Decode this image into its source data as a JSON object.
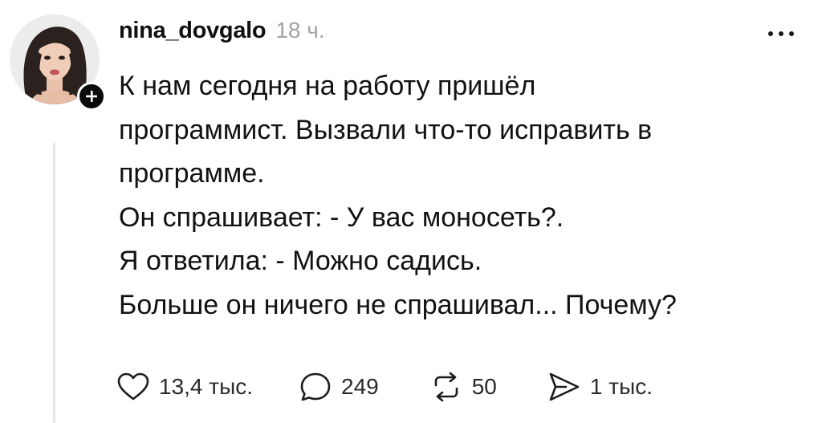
{
  "post": {
    "username": "nina_dovgalo",
    "timestamp": "18 ч.",
    "lines": [
      "К нам сегодня на работу пришёл",
      "программист. Вызвали что-то исправить в",
      "программе.",
      "Он спрашивает: - У вас моносеть?.",
      "Я ответила: - Можно садись.",
      "Больше он ничего не спрашивал... Почему?"
    ],
    "actions": {
      "likes": "13,4 тыс.",
      "replies": "249",
      "reposts": "50",
      "shares": "1 тыс."
    }
  },
  "icons": {
    "avatar": "avatar-photo",
    "follow": "plus-icon",
    "more": "more-dots-icon",
    "like": "heart-icon",
    "reply": "comment-bubble-icon",
    "repost": "repost-arrows-icon",
    "share": "send-icon"
  },
  "colors": {
    "text": "#121212",
    "muted": "#a3a3a3",
    "thread_line": "#e3e3e3",
    "badge": "#0a0a0a"
  }
}
